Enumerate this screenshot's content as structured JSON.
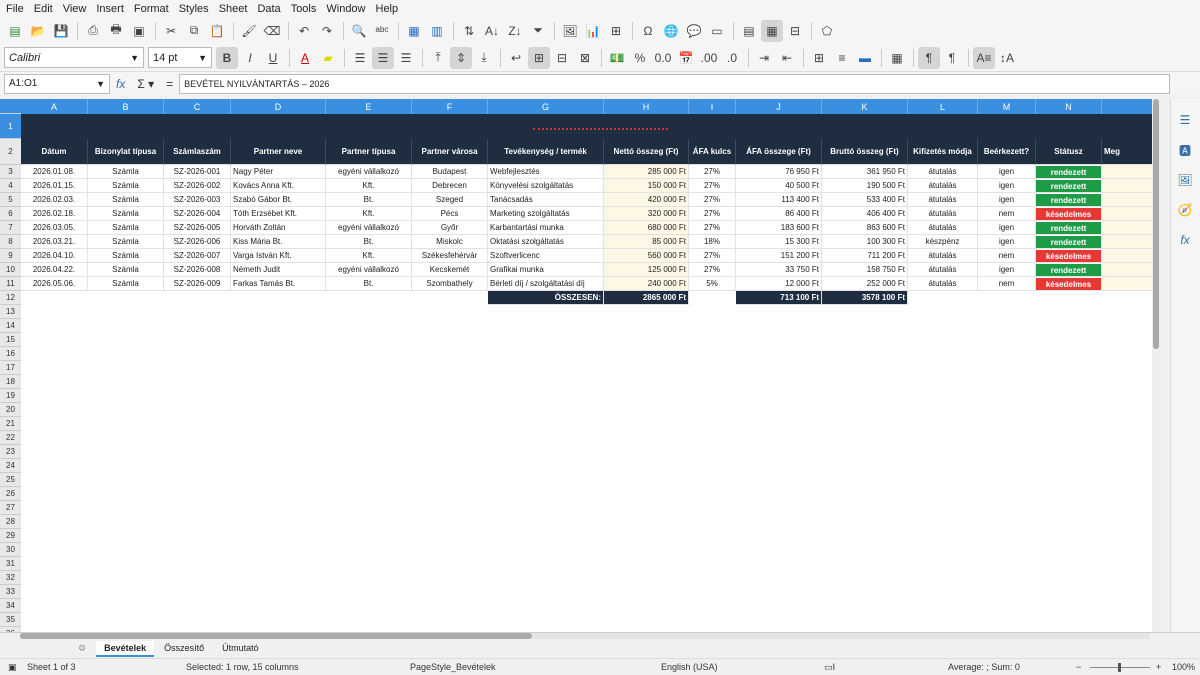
{
  "menu": [
    "File",
    "Edit",
    "View",
    "Insert",
    "Format",
    "Styles",
    "Sheet",
    "Data",
    "Tools",
    "Window",
    "Help"
  ],
  "format": {
    "font_name": "Calibri",
    "font_size": "14 pt"
  },
  "formula": {
    "cell_ref": "A1:O1",
    "content": "BEVÉTEL NYILVÁNTARTÁS – 2026"
  },
  "columns": [
    "A",
    "B",
    "C",
    "D",
    "E",
    "F",
    "G",
    "H",
    "I",
    "J",
    "K",
    "L",
    "M",
    "N"
  ],
  "headers": [
    "Dátum",
    "Bizonylat típusa",
    "Számlaszám",
    "Partner neve",
    "Partner típusa",
    "Partner városa",
    "Tevékenység / termék",
    "Nettó összeg (Ft)",
    "ÁFA kulcs",
    "ÁFA összege (Ft)",
    "Bruttó összeg (Ft)",
    "Kifizetés módja",
    "Beérkezett?",
    "Státusz",
    "Meg"
  ],
  "rows": [
    [
      "2026.01.08.",
      "Számla",
      "SZ-2026-001",
      "Nagy Péter",
      "egyéni vállalkozó",
      "Budapest",
      "Webfejlesztés",
      "285 000 Ft",
      "27%",
      "76 950 Ft",
      "361 950 Ft",
      "átutalás",
      "igen",
      "rendezett"
    ],
    [
      "2026.01.15.",
      "Számla",
      "SZ-2026-002",
      "Kovács Anna Kft.",
      "Kft.",
      "Debrecen",
      "Könyvelési szolgáltatás",
      "150 000 Ft",
      "27%",
      "40 500 Ft",
      "190 500 Ft",
      "átutalás",
      "igen",
      "rendezett"
    ],
    [
      "2026.02.03.",
      "Számla",
      "SZ-2026-003",
      "Szabó Gábor Bt.",
      "Bt.",
      "Szeged",
      "Tanácsadás",
      "420 000 Ft",
      "27%",
      "113 400 Ft",
      "533 400 Ft",
      "átutalás",
      "igen",
      "rendezett"
    ],
    [
      "2026.02.18.",
      "Számla",
      "SZ-2026-004",
      "Tóth Erzsébet Kft.",
      "Kft.",
      "Pécs",
      "Marketing szolgáltatás",
      "320 000 Ft",
      "27%",
      "86 400 Ft",
      "406 400 Ft",
      "átutalás",
      "nem",
      "késedelmes"
    ],
    [
      "2026.03.05.",
      "Számla",
      "SZ-2026-005",
      "Horváth Zoltán",
      "egyéni vállalkozó",
      "Győr",
      "Karbantartási munka",
      "680 000 Ft",
      "27%",
      "183 600 Ft",
      "863 600 Ft",
      "átutalás",
      "igen",
      "rendezett"
    ],
    [
      "2026.03.21.",
      "Számla",
      "SZ-2026-006",
      "Kiss Mária Bt.",
      "Bt.",
      "Miskolc",
      "Oktatási szolgáltatás",
      "85 000 Ft",
      "18%",
      "15 300 Ft",
      "100 300 Ft",
      "készpénz",
      "igen",
      "rendezett"
    ],
    [
      "2026.04.10.",
      "Számla",
      "SZ-2026-007",
      "Varga István Kft.",
      "Kft.",
      "Székesfehérvár",
      "Szoftverlicenc",
      "560 000 Ft",
      "27%",
      "151 200 Ft",
      "711 200 Ft",
      "átutalás",
      "nem",
      "késedelmes"
    ],
    [
      "2026.04.22.",
      "Számla",
      "SZ-2026-008",
      "Németh Judit",
      "egyéni vállalkozó",
      "Kecskemét",
      "Grafikai munka",
      "125 000 Ft",
      "27%",
      "33 750 Ft",
      "158 750 Ft",
      "átutalás",
      "igen",
      "rendezett"
    ],
    [
      "2026.05.06.",
      "Számla",
      "SZ-2026-009",
      "Farkas Tamás Bt.",
      "Bt.",
      "Szombathely",
      "Bérleti díj / szolgáltatási díj",
      "240 000 Ft",
      "5%",
      "12 000 Ft",
      "252 000 Ft",
      "átutalás",
      "nem",
      "késedelmes"
    ]
  ],
  "totals": {
    "label": "ÖSSZESEN:",
    "net": "2865 000 Ft",
    "vat": "713 100 Ft",
    "gross": "3578 100 Ft"
  },
  "sheets": [
    "Bevételek",
    "Összesítő",
    "Útmutató"
  ],
  "status": {
    "sheet": "Sheet 1 of 3",
    "selected": "Selected: 1 row, 15 columns",
    "page_style": "PageStyle_Bevételek",
    "language": "English (USA)",
    "sum": "Average: ; Sum: 0",
    "zoom": "100%"
  }
}
